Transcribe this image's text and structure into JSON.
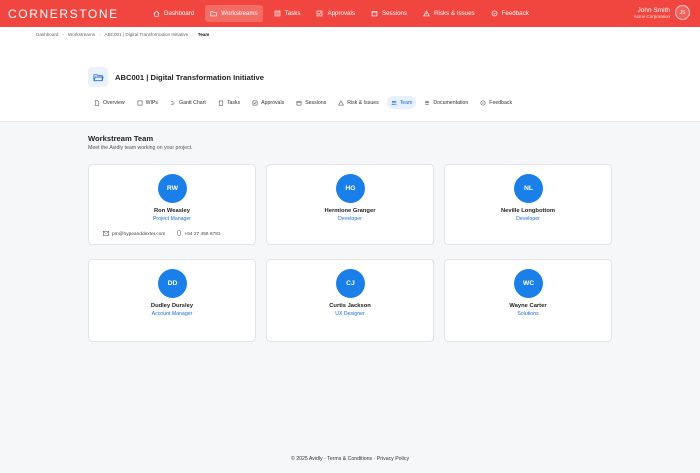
{
  "brand": "CORNERSTONE",
  "nav": [
    {
      "label": "Dashboard",
      "icon": "home-icon"
    },
    {
      "label": "Workstreams",
      "icon": "folder-icon"
    },
    {
      "label": "Tasks",
      "icon": "list-icon"
    },
    {
      "label": "Approvals",
      "icon": "check-icon"
    },
    {
      "label": "Sessions",
      "icon": "calendar-icon"
    },
    {
      "label": "Risks & Issues",
      "icon": "warning-icon"
    },
    {
      "label": "Feedback",
      "icon": "chat-icon"
    }
  ],
  "user": {
    "name": "John Smith",
    "org": "Acme Corporation",
    "initials": "JS"
  },
  "breadcrumb": [
    "Dashboard",
    "Workstreams",
    "ABC001 | Digital Transformation Initiative",
    "Team"
  ],
  "project": {
    "title": "ABC001 | Digital Transformation Initiative"
  },
  "tabs": [
    "Overview",
    "WIPs",
    "Gantt Chart",
    "Tasks",
    "Approvals",
    "Sessions",
    "Risk & Issues",
    "Team",
    "Documentation",
    "Feedback"
  ],
  "section": {
    "title": "Workstream Team",
    "subtitle": "Meet the Avidly team working on your project."
  },
  "members": [
    {
      "initials": "RW",
      "name": "Ron Weasley",
      "role": "Project Manager",
      "email": "pm@hypeanddexter.com",
      "phone": "+64 27 456 6781"
    },
    {
      "initials": "HG",
      "name": "Hermione Granger",
      "role": "Developer"
    },
    {
      "initials": "NL",
      "name": "Neville Longbottom",
      "role": "Developer"
    },
    {
      "initials": "DD",
      "name": "Dudley Dursley",
      "role": "Account Manager"
    },
    {
      "initials": "CJ",
      "name": "Curtis Jackson",
      "role": "UX Designer"
    },
    {
      "initials": "WC",
      "name": "Wayne Carter",
      "role": "Solutions"
    }
  ],
  "footer": "© 2025 Avidly · Terms & Conditions · Privacy Policy",
  "colors": {
    "brand": "#f0463f",
    "accent": "#1a7fe8"
  }
}
